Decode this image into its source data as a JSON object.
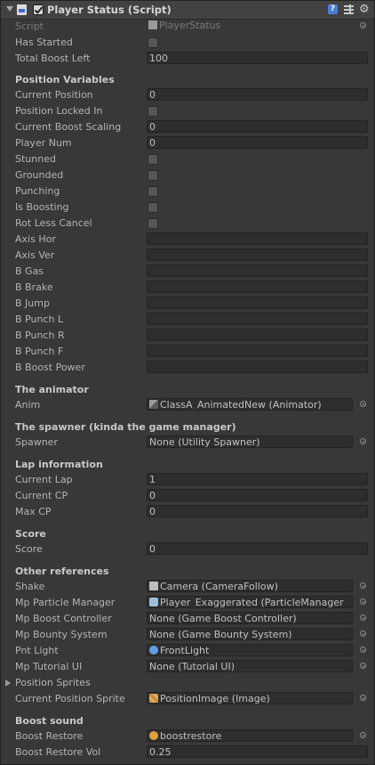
{
  "component": {
    "title": "Player Status (Script)",
    "icon": "script-icon",
    "enabled": true
  },
  "top": [
    {
      "label": "Script",
      "type": "script",
      "value": "PlayerStatus"
    },
    {
      "label": "Has Started",
      "type": "bool",
      "value": false
    },
    {
      "label": "Total Boost Left",
      "type": "text",
      "value": "100"
    }
  ],
  "position_variables": {
    "heading": "Position Variables",
    "fields": [
      {
        "label": "Current Position",
        "type": "text",
        "value": "0"
      },
      {
        "label": "Position Locked In",
        "type": "bool",
        "value": false
      },
      {
        "label": "Current Boost Scaling",
        "type": "text",
        "value": "0"
      },
      {
        "label": "Player Num",
        "type": "text",
        "value": "0"
      },
      {
        "label": "Stunned",
        "type": "bool",
        "value": false
      },
      {
        "label": "Grounded",
        "type": "bool",
        "value": false
      },
      {
        "label": "Punching",
        "type": "bool",
        "value": false
      },
      {
        "label": "Is Boosting",
        "type": "bool",
        "value": false
      },
      {
        "label": "Rot Less Cancel",
        "type": "bool",
        "value": false
      },
      {
        "label": "Axis Hor",
        "type": "text",
        "value": ""
      },
      {
        "label": "Axis Ver",
        "type": "text",
        "value": ""
      },
      {
        "label": "B Gas",
        "type": "text",
        "value": ""
      },
      {
        "label": "B Brake",
        "type": "text",
        "value": ""
      },
      {
        "label": "B Jump",
        "type": "text",
        "value": ""
      },
      {
        "label": "B Punch L",
        "type": "text",
        "value": ""
      },
      {
        "label": "B Punch R",
        "type": "text",
        "value": ""
      },
      {
        "label": "B Punch F",
        "type": "text",
        "value": ""
      },
      {
        "label": "B Boost Power",
        "type": "text",
        "value": ""
      }
    ]
  },
  "animator_section": {
    "heading": "The animator",
    "fields": [
      {
        "label": "Anim",
        "type": "object",
        "icon": "animator-icon",
        "value": "ClassA_AnimatedNew (Animator)"
      }
    ]
  },
  "spawner_section": {
    "heading": "The spawner (kinda the game manager)",
    "fields": [
      {
        "label": "Spawner",
        "type": "object",
        "value": "None (Utility Spawner)"
      }
    ]
  },
  "lap_section": {
    "heading": "Lap information",
    "fields": [
      {
        "label": "Current Lap",
        "type": "text",
        "value": "1"
      },
      {
        "label": "Current CP",
        "type": "text",
        "value": "0"
      },
      {
        "label": "Max CP",
        "type": "text",
        "value": "0"
      }
    ]
  },
  "score_section": {
    "heading": "Score",
    "fields": [
      {
        "label": "Score",
        "type": "text",
        "value": "0"
      }
    ]
  },
  "refs_section": {
    "heading": "Other references",
    "fields": [
      {
        "label": "Shake",
        "type": "object",
        "icon": "camera-icon",
        "value": "Camera (CameraFollow)"
      },
      {
        "label": "Mp Particle Manager",
        "type": "object",
        "icon": "particle-icon",
        "value": "Player_Exaggerated (ParticleManager"
      },
      {
        "label": "Mp Boost Controller",
        "type": "object",
        "value": "None (Game Boost Controller)"
      },
      {
        "label": "Mp Bounty System",
        "type": "object",
        "value": "None (Game Bounty System)"
      },
      {
        "label": "Pnt Light",
        "type": "object",
        "icon": "light-icon",
        "value": "FrontLight"
      },
      {
        "label": "Mp Tutorial UI",
        "type": "object",
        "value": "None (Tutorial UI)"
      },
      {
        "label": "Position Sprites",
        "type": "foldout",
        "value": ""
      },
      {
        "label": "Current Position Sprite",
        "type": "object",
        "icon": "image-icon",
        "value": "PositionImage (Image)"
      }
    ]
  },
  "sound_section": {
    "heading": "Boost sound",
    "fields": [
      {
        "label": "Boost Restore",
        "type": "object",
        "icon": "audio-icon",
        "value": "boostrestore"
      },
      {
        "label": "Boost Restore Vol",
        "type": "text",
        "value": "0.25"
      }
    ]
  }
}
